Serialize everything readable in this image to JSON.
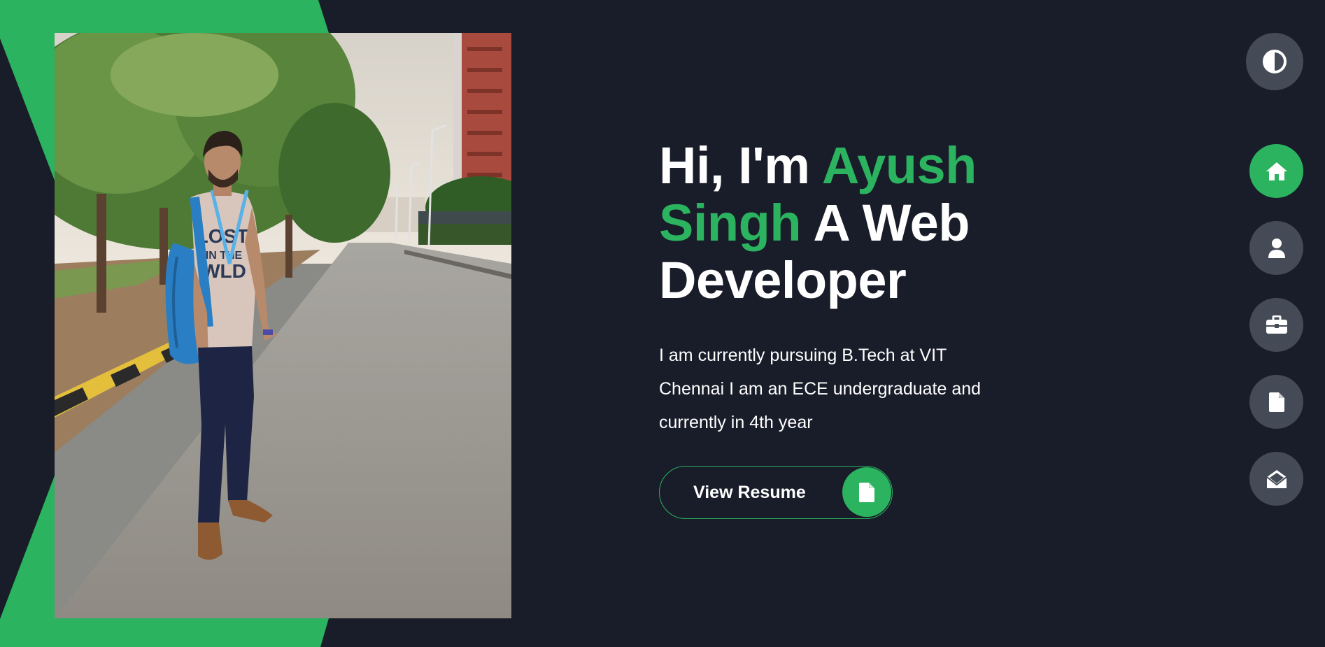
{
  "hero": {
    "greeting": "Hi, I'm ",
    "name_part1": "Ayush",
    "name_part2": "Singh",
    "role": " A Web Developer",
    "description": "I am currently pursuing B.Tech at VIT Chennai I am an ECE undergraduate and currently in 4th year",
    "resume_button_label": "View Resume"
  },
  "photo": {
    "shirt_text_line1": "LOST",
    "shirt_text_line2": "IN THE",
    "shirt_text_line3": "WLD"
  },
  "side_nav": {
    "theme_toggle_icon": "contrast-icon",
    "items": [
      {
        "icon": "home-icon",
        "active": true
      },
      {
        "icon": "user-icon",
        "active": false
      },
      {
        "icon": "briefcase-icon",
        "active": false
      },
      {
        "icon": "file-icon",
        "active": false
      },
      {
        "icon": "envelope-open-icon",
        "active": false
      }
    ]
  },
  "colors": {
    "background": "#191c29",
    "accent": "#2bb35f",
    "nav_button": "#454b56",
    "text": "#ffffff"
  }
}
